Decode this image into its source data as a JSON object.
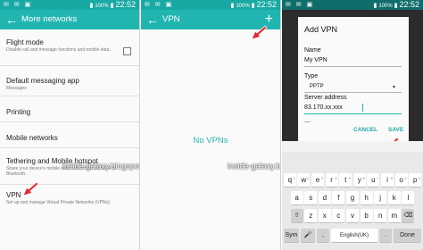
{
  "status_bar": {
    "left_icons": "✉ ✉ ▣",
    "battery_pct": "100%",
    "time": "22:52"
  },
  "panel1": {
    "title": "More networks",
    "items": [
      {
        "title": "Flight mode",
        "subtitle": "Disable call and message functions and mobile data."
      },
      {
        "title": "Default messaging app",
        "subtitle": "Messages"
      },
      {
        "title": "Printing",
        "subtitle": ""
      },
      {
        "title": "Mobile networks",
        "subtitle": ""
      },
      {
        "title": "Tethering and Mobile hotspot",
        "subtitle": "Share your device's mobile data connection via Wi-Fi or Bluetooth."
      },
      {
        "title": "VPN",
        "subtitle": "Set up and manage Virtual Private Networks (VPNs)."
      }
    ]
  },
  "panel2": {
    "title": "VPN",
    "add_icon": "+",
    "empty_text": "No VPNs"
  },
  "dialog": {
    "title": "Add VPN",
    "name_label": "Name",
    "name_value": "My VPN",
    "type_label": "Type",
    "type_value": "PPTP",
    "server_label": "Server address",
    "server_value": "83.170.xx.xxx",
    "cancel_label": "CANCEL",
    "save_label": "SAVE"
  },
  "watermark": "inside-galaxy.blogspot.com",
  "keyboard": {
    "rows": [
      [
        "q",
        "w",
        "e",
        "r",
        "t",
        "y",
        "u",
        "i",
        "o",
        "p"
      ],
      [
        "a",
        "s",
        "d",
        "f",
        "g",
        "h",
        "j",
        "k",
        "l"
      ],
      [
        "⇧",
        "z",
        "x",
        "c",
        "v",
        "b",
        "n",
        "m",
        "⌫"
      ]
    ],
    "bottom": {
      "sym_label": "Sym",
      "mic_icon": "🎤",
      "comma": ",",
      "space_label": "English(UK)",
      "period": ".",
      "done_label": "Done"
    },
    "top_alt": [
      "1",
      "2",
      "3",
      "4",
      "5",
      "6",
      "7",
      "8",
      "9",
      "0"
    ]
  },
  "colors": {
    "appbar": "#21b5b1",
    "statusbar": "#18a9a5",
    "accent": "#2ab3b0",
    "arrow": "#e3282f"
  }
}
